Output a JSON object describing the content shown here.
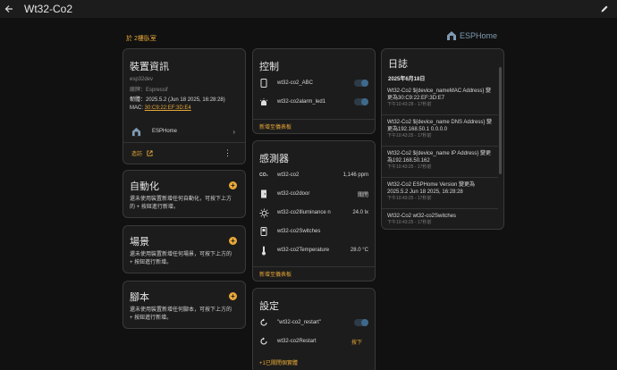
{
  "header": {
    "title": "Wt32-Co2"
  },
  "area_link": "於 2樓臥室",
  "brand": {
    "name": "ESPHome",
    "color": "#7f9bb3",
    "icon": "esphome-house-icon"
  },
  "accent": "#e8a838",
  "device_info": {
    "title": "裝置資訊",
    "model": "esp32dev",
    "manufacturer": "廠牌：Espressif",
    "firmware": "韌體：2025.5.2 (Jun 18 2025, 16:28:28)",
    "mac_label": "MAC:",
    "mac_value": "30:C9:22:EF:3D:E4",
    "integration": "ESPHome",
    "visit": "造訪"
  },
  "automation": {
    "title": "自動化",
    "desc": "還未使用裝置新增任何自動化，可按下上方的 + 按鈕進行新增。"
  },
  "scene": {
    "title": "場景",
    "desc": "還未使用裝置新增任何場景，可按下上方的 + 按鈕進行新增。"
  },
  "script": {
    "title": "腳本",
    "desc": "還未使用裝置新增任何腳本，可按下上方的 + 按鈕進行新增。"
  },
  "controls": {
    "title": "控制",
    "items": [
      {
        "icon": "phone-icon",
        "name": "wt32-co2_ABC",
        "state": "off"
      },
      {
        "icon": "alarm-light-icon",
        "name": "wt32-co2alarm_led1",
        "state": "off"
      }
    ],
    "footer": "新增至儀表板"
  },
  "sensors": {
    "title": "感測器",
    "items": [
      {
        "icon": "co2-icon",
        "name": "wt32-co2",
        "value": "1,146 ppm"
      },
      {
        "icon": "door-icon",
        "name": "wt32-co2door",
        "value": "關閉"
      },
      {
        "icon": "brightness-icon",
        "name": "wt32-co2Illuminance n",
        "value": "24.0 lx"
      },
      {
        "icon": "switch-icon",
        "name": "wt32-co2Switches",
        "value": ""
      },
      {
        "icon": "thermometer-icon",
        "name": "wt32-co2Temperature",
        "value": "28.0 °C"
      }
    ],
    "footer": "新增至儀表板"
  },
  "config": {
    "title": "設定",
    "items": [
      {
        "icon": "restart-icon",
        "name": "\"wt32-co2_restart\"",
        "kind": "toggle"
      },
      {
        "icon": "restart-icon",
        "name": "wt32-co2Restart",
        "action": "按下"
      }
    ],
    "footer": "+1已關閉個實體"
  },
  "logbook": {
    "title": "日誌",
    "date": "2025年6月18日",
    "entries": [
      {
        "text": "Wt32-Co2 ${device_nameMAC Address} 變更為30:C9:22:EF:3D:E7",
        "time": "下午10:43:28 - 17秒前"
      },
      {
        "text": "Wt32-Co2 ${device_name DNS Address} 變更為192.168.50.1 0.0.0.0",
        "time": "下午10:43:25 - 17秒前"
      },
      {
        "text": "Wt32-Co2 ${device_name IP Address} 變更為192.168.50.162",
        "time": "下午10:43:25 - 17秒前"
      },
      {
        "text": "Wt32-Co2 ESPHome Version 變更為 2025.5.2 Jun 18 2025, 16:28:28",
        "time": "下午10:43:25 - 17秒前"
      },
      {
        "text": "Wt32-Co2 wt32-co2Switches",
        "time": "下午10:43:25 - 17秒前"
      }
    ]
  }
}
